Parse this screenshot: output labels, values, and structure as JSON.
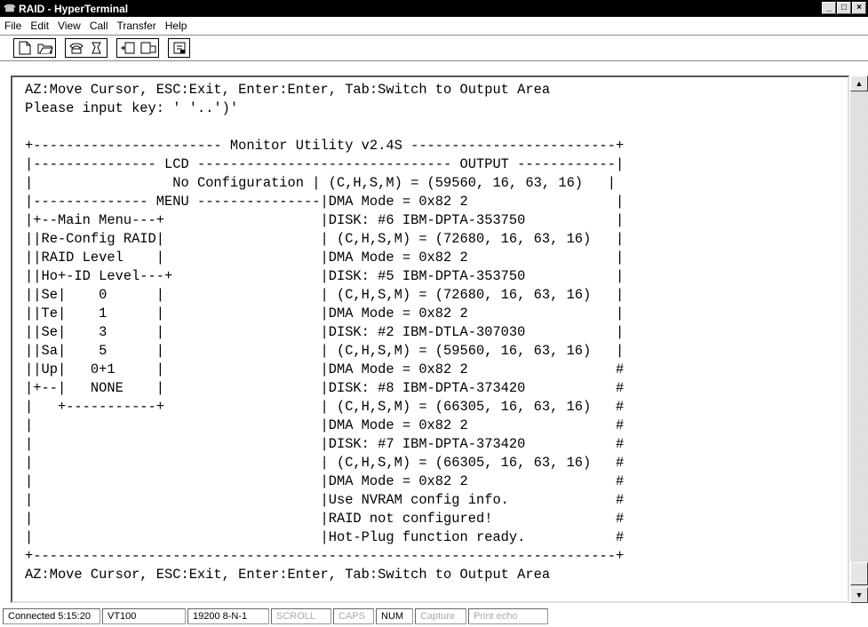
{
  "window": {
    "title": "RAID - HyperTerminal",
    "controls": [
      "_",
      "□",
      "×"
    ]
  },
  "menu": {
    "items": [
      "File",
      "Edit",
      "View",
      "Call",
      "Transfer",
      "Help"
    ]
  },
  "toolbar": {
    "buttons": [
      "new-icon",
      "open-icon",
      "connect-icon",
      "disconnect-icon",
      "send-icon",
      "receive-icon",
      "properties-icon"
    ]
  },
  "terminal": {
    "lines": [
      "AZ:Move Cursor, ESC:Exit, Enter:Enter, Tab:Switch to Output Area",
      "Please input key: ' '..')'",
      "",
      "+----------------------- Monitor Utility v2.4S -------------------------+",
      "|--------------- LCD ------------------------------- OUTPUT ------------|",
      "|                 No Configuration | (C,H,S,M) = (59560, 16, 63, 16)   |",
      "|-------------- MENU ---------------|DMA Mode = 0x82 2                  |",
      "|+--Main Menu---+                   |DISK: #6 IBM-DPTA-353750           |",
      "||Re-Config RAID|                   | (C,H,S,M) = (72680, 16, 63, 16)   |",
      "||RAID Level    |                   |DMA Mode = 0x82 2                  |",
      "||Ho+-ID Level---+                  |DISK: #5 IBM-DPTA-353750           |",
      "||Se|    0      |                   | (C,H,S,M) = (72680, 16, 63, 16)   |",
      "||Te|    1      |                   |DMA Mode = 0x82 2                  |",
      "||Se|    3      |                   |DISK: #2 IBM-DTLA-307030           |",
      "||Sa|    5      |                   | (C,H,S,M) = (59560, 16, 63, 16)   |",
      "||Up|   0+1     |                   |DMA Mode = 0x82 2                  #",
      "|+--|   NONE    |                   |DISK: #8 IBM-DPTA-373420           #",
      "|   +-----------+                   | (C,H,S,M) = (66305, 16, 63, 16)   #",
      "|                                   |DMA Mode = 0x82 2                  #",
      "|                                   |DISK: #7 IBM-DPTA-373420           #",
      "|                                   | (C,H,S,M) = (66305, 16, 63, 16)   #",
      "|                                   |DMA Mode = 0x82 2                  #",
      "|                                   |Use NVRAM config info.             #",
      "|                                   |RAID not configured!               #",
      "|                                   |Hot-Plug function ready.           #",
      "+-----------------------------------------------------------------------+",
      "AZ:Move Cursor, ESC:Exit, Enter:Enter, Tab:Switch to Output Area"
    ]
  },
  "status": {
    "connected": "Connected 5:15:20",
    "emulation": "VT100",
    "settings": "19200 8-N-1",
    "scroll": "SCROLL",
    "caps": "CAPS",
    "num": "NUM",
    "capture": "Capture",
    "print_echo": "Print echo"
  }
}
